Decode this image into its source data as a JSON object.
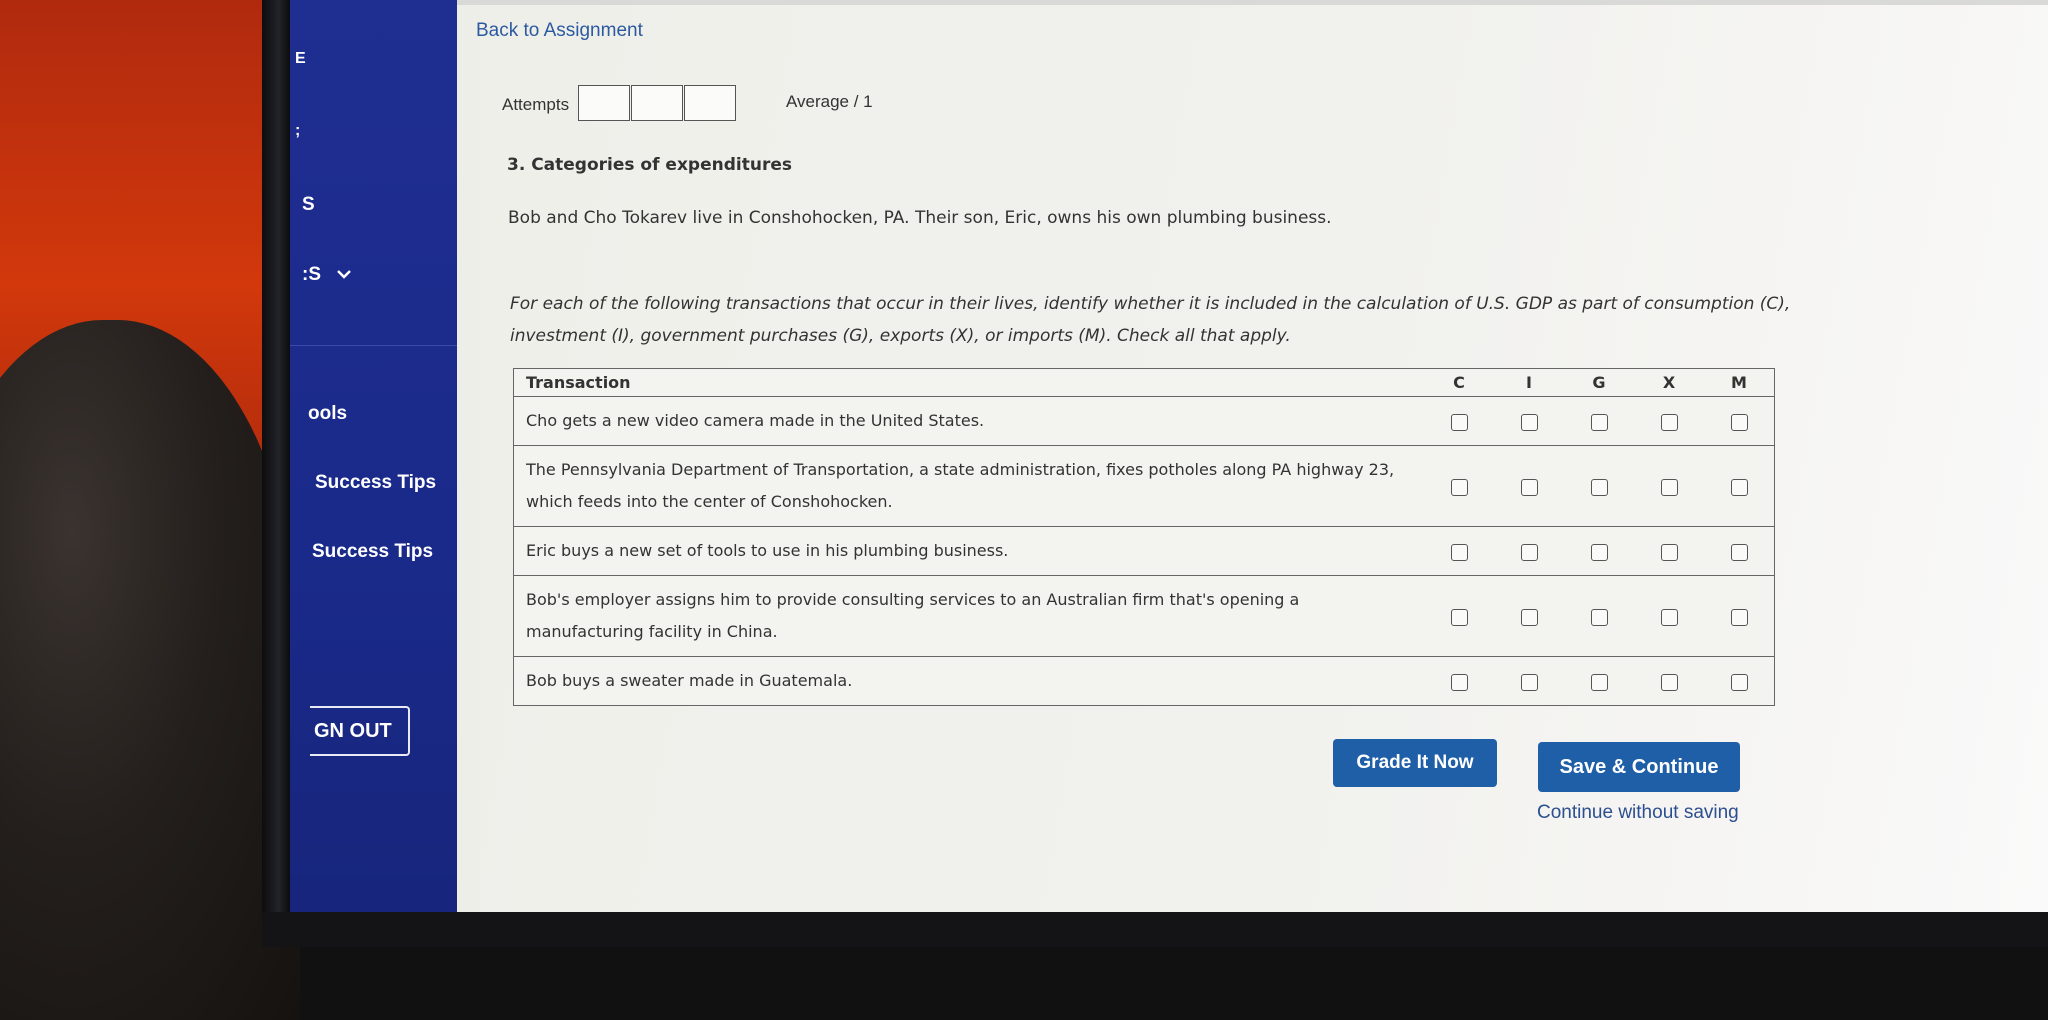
{
  "sidebar": {
    "item_e": "E",
    "item_semicolon": ";",
    "item_s": "S",
    "item_s_dropdown": ":S",
    "item_tools": "ools",
    "item_success_tips_1": "Success Tips",
    "item_success_tips_2": "Success Tips",
    "signout_label": "GN OUT"
  },
  "header": {
    "back_link": "Back to Assignment",
    "attempts_label": "Attempts",
    "average_label": "Average / 1"
  },
  "question": {
    "title": "3. Categories of expenditures",
    "intro": "Bob and Cho Tokarev live in Conshohocken, PA. Their son, Eric, owns his own plumbing business.",
    "instructions": "For each of the following transactions that occur in their lives, identify whether it is included in the calculation of U.S. GDP as part of consumption (C), investment (I), government purchases (G), exports (X), or imports (M). Check all that apply."
  },
  "table": {
    "header_transaction": "Transaction",
    "columns": [
      "C",
      "I",
      "G",
      "X",
      "M"
    ],
    "rows": [
      "Cho gets a new video camera made in the United States.",
      "The Pennsylvania Department of Transportation, a state administration, fixes potholes along PA highway 23, which feeds into the center of Conshohocken.",
      "Eric buys a new set of tools to use in his plumbing business.",
      "Bob's employer assigns him to provide consulting services to an Australian firm that's opening a manufacturing facility in China.",
      "Bob buys a sweater made in Guatemala."
    ]
  },
  "actions": {
    "grade_label": "Grade It Now",
    "save_label": "Save & Continue",
    "continue_label": "Continue without saving"
  },
  "colors": {
    "sidebar": "#1f2e91",
    "button": "#1f5fa8",
    "link": "#2c5aa0"
  }
}
